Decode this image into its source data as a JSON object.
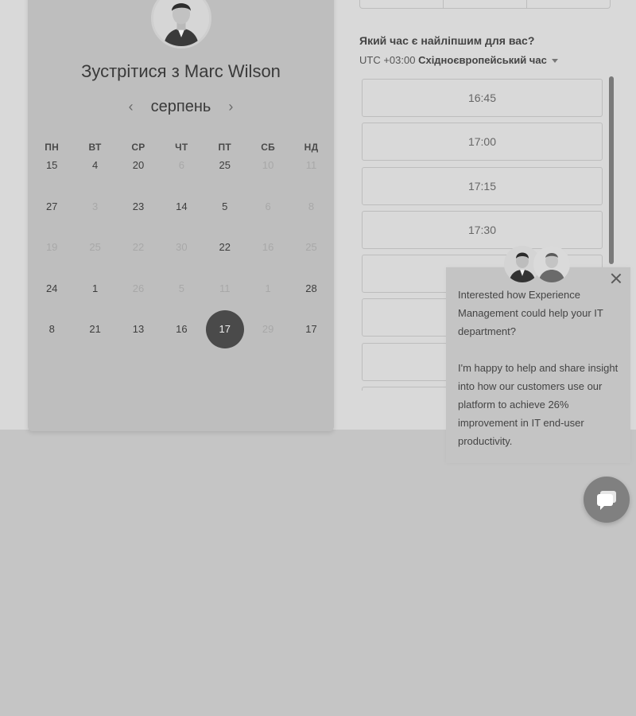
{
  "header": {
    "title_prefix": "Зустрітися з ",
    "host_name": "Marc Wilson"
  },
  "calendar": {
    "month": "серпень",
    "prev_icon": "chevron-left-icon",
    "next_icon": "chevron-right-icon",
    "weekdays": [
      "ПН",
      "ВТ",
      "СР",
      "ЧТ",
      "ПТ",
      "СБ",
      "НД"
    ],
    "weeks": [
      [
        {
          "d": "15",
          "s": "n"
        },
        {
          "d": "4",
          "s": "n"
        },
        {
          "d": "20",
          "s": "n"
        },
        {
          "d": "6",
          "s": "dim"
        },
        {
          "d": "25",
          "s": "n"
        },
        {
          "d": "10",
          "s": "dim"
        },
        {
          "d": "11",
          "s": "dim"
        }
      ],
      [
        {
          "d": "27",
          "s": "n"
        },
        {
          "d": "3",
          "s": "dim"
        },
        {
          "d": "23",
          "s": "n"
        },
        {
          "d": "14",
          "s": "n"
        },
        {
          "d": "5",
          "s": "n"
        },
        {
          "d": "6",
          "s": "dim"
        },
        {
          "d": "8",
          "s": "dim"
        }
      ],
      [
        {
          "d": "19",
          "s": "dim"
        },
        {
          "d": "25",
          "s": "dim"
        },
        {
          "d": "22",
          "s": "dim"
        },
        {
          "d": "30",
          "s": "dim"
        },
        {
          "d": "22",
          "s": "n"
        },
        {
          "d": "16",
          "s": "dim"
        },
        {
          "d": "25",
          "s": "dim"
        }
      ],
      [
        {
          "d": "24",
          "s": "n"
        },
        {
          "d": "1",
          "s": "n"
        },
        {
          "d": "26",
          "s": "dim"
        },
        {
          "d": "5",
          "s": "dim"
        },
        {
          "d": "11",
          "s": "dim"
        },
        {
          "d": "1",
          "s": "dim"
        },
        {
          "d": "28",
          "s": "n"
        }
      ],
      [
        {
          "d": "8",
          "s": "n"
        },
        {
          "d": "21",
          "s": "n"
        },
        {
          "d": "13",
          "s": "n"
        },
        {
          "d": "16",
          "s": "n"
        },
        {
          "d": "17",
          "s": "sel"
        },
        {
          "d": "29",
          "s": "dim"
        },
        {
          "d": "17",
          "s": "n"
        }
      ]
    ]
  },
  "booking": {
    "question": "Який час є найліпшим для вас?",
    "tz_offset": "UTC +03:00 ",
    "tz_name": "Східноєвропейський час",
    "slots": [
      "16:45",
      "17:00",
      "17:15",
      "17:30",
      "",
      "",
      "",
      ""
    ]
  },
  "chat": {
    "message_1": "Interested how Experience Management could help your IT department?",
    "message_2": "I'm happy to help and share insight into how our customers use our platform to achieve 26% improvement in IT end-user productivity.",
    "close_icon": "close-icon",
    "launcher_icon": "chat-bubble-icon"
  }
}
